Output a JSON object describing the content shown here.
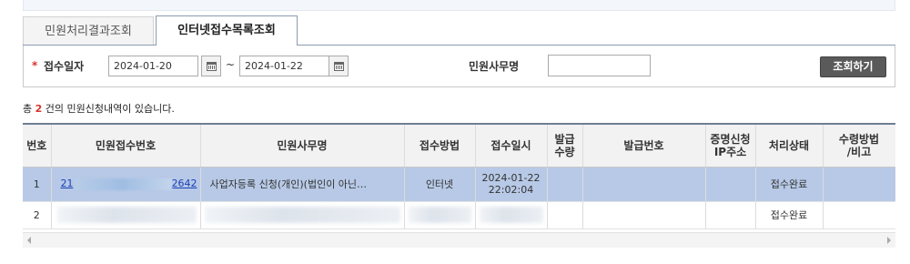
{
  "tabs": [
    {
      "label": "민원처리결과조회",
      "active": false
    },
    {
      "label": "인터넷접수목록조회",
      "active": true
    }
  ],
  "search": {
    "date_label": "접수일자",
    "start_date": "2024-01-20",
    "end_date": "2024-01-22",
    "range_sep": "~",
    "name_label": "민원사무명",
    "name_value": "",
    "button_label": "조회하기"
  },
  "summary": {
    "prefix": "총 ",
    "count": "2",
    "suffix": " 건의 민원신청내역이 있습니다."
  },
  "table": {
    "headers": [
      "번호",
      "민원접수번호",
      "민원사무명",
      "접수방법",
      "접수일시",
      "발급수량",
      "발급번호",
      "증명신청IP주소",
      "처리상태",
      "수령방법/비고"
    ],
    "header_lines": {
      "issue_qty": [
        "발급",
        "수량"
      ],
      "ip": [
        "증명신청",
        "IP주소"
      ],
      "receive": [
        "수령방법",
        "/비고"
      ]
    },
    "rows": [
      {
        "no": "1",
        "receipt_prefix": "21",
        "receipt_suffix": "2642",
        "name": "사업자등록 신청(개인)(법인이 아닌…",
        "method": "인터넷",
        "date": "2024-01-22",
        "time": "22:02:04",
        "qty": "",
        "issue_no": "",
        "ip": "",
        "status": "접수완료",
        "note": ""
      },
      {
        "no": "2",
        "status": "접수완료"
      }
    ]
  },
  "colors": {
    "selected_row": "#b7c9e6",
    "link": "#1a3fb8",
    "required": "#d9342b",
    "button": "#5a5a5a"
  }
}
